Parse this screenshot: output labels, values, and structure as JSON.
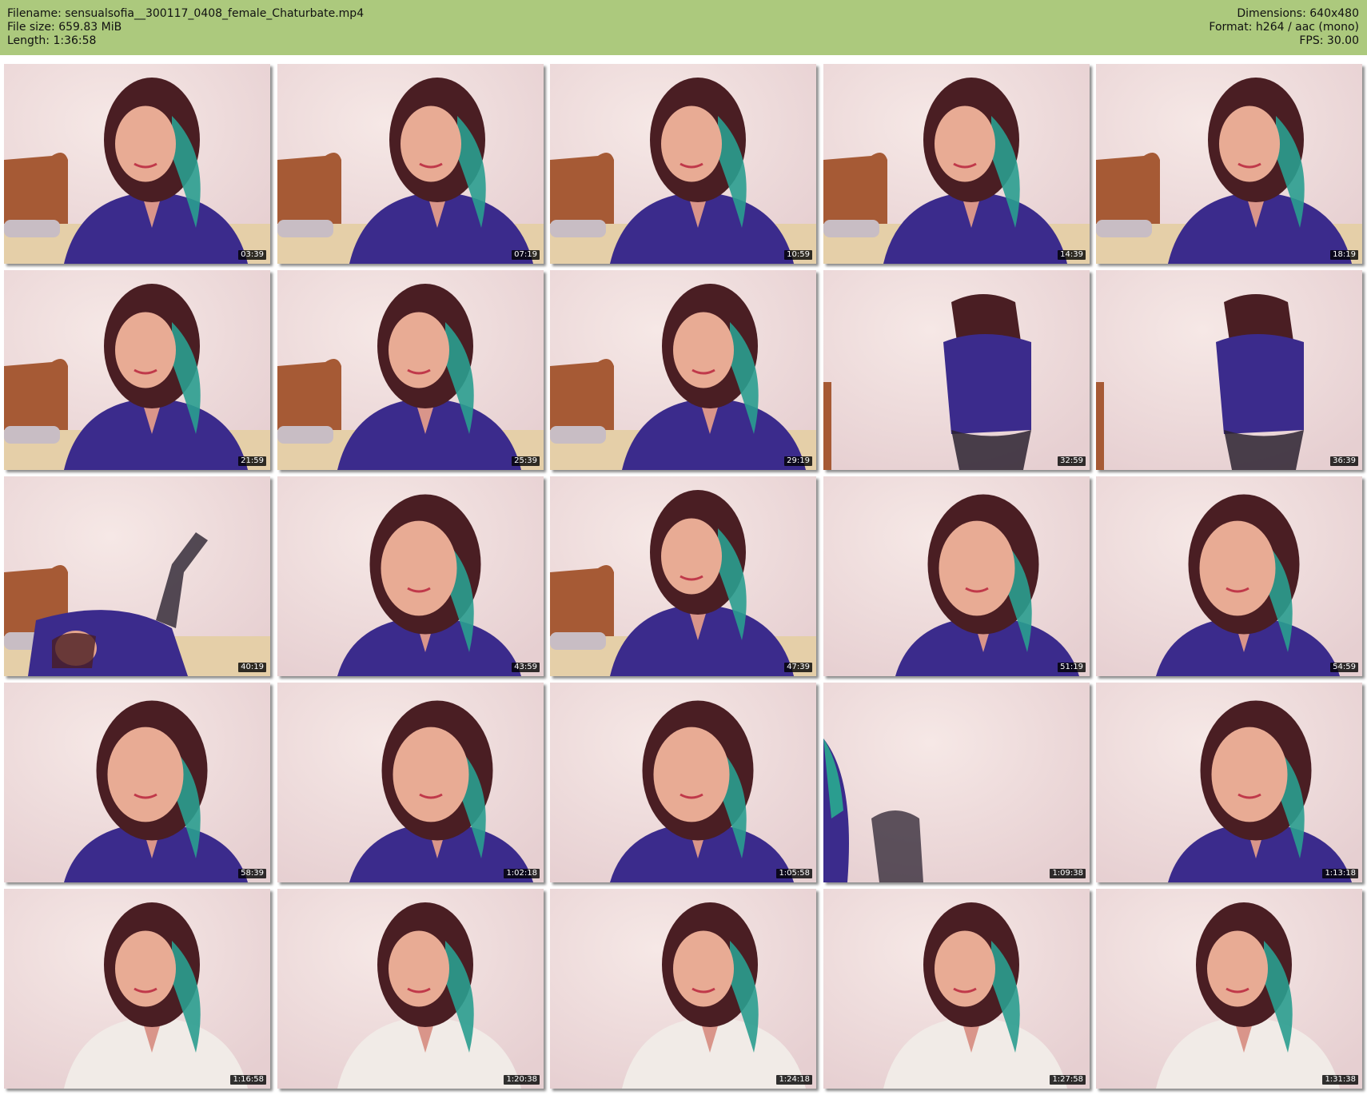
{
  "header": {
    "filename": "Filename: sensualsofia__300117_0408_female_Chaturbate.mp4",
    "filesize": "File size: 659.83 MiB",
    "length": "Length: 1:36:58",
    "dimensions": "Dimensions: 640x480",
    "format": "Format: h264 / aac (mono)",
    "fps": "FPS: 30.00"
  },
  "colors": {
    "header_bg": "#acc97d",
    "shirt_purple": "#3b2b8c",
    "hair_teal": "#2a9d8f",
    "wall_pink": "#ead7d6"
  },
  "thumbnails": [
    {
      "timestamp": "03:39",
      "scene": "bed"
    },
    {
      "timestamp": "07:19",
      "scene": "bed"
    },
    {
      "timestamp": "10:59",
      "scene": "bed"
    },
    {
      "timestamp": "14:39",
      "scene": "bed"
    },
    {
      "timestamp": "18:19",
      "scene": "bed"
    },
    {
      "timestamp": "21:59",
      "scene": "bed"
    },
    {
      "timestamp": "25:39",
      "scene": "bed"
    },
    {
      "timestamp": "29:19",
      "scene": "bed"
    },
    {
      "timestamp": "32:59",
      "scene": "wall"
    },
    {
      "timestamp": "36:39",
      "scene": "wall"
    },
    {
      "timestamp": "40:19",
      "scene": "lying"
    },
    {
      "timestamp": "43:59",
      "scene": "close"
    },
    {
      "timestamp": "47:39",
      "scene": "bed"
    },
    {
      "timestamp": "51:19",
      "scene": "close"
    },
    {
      "timestamp": "54:59",
      "scene": "close"
    },
    {
      "timestamp": "58:39",
      "scene": "close"
    },
    {
      "timestamp": "1:02:18",
      "scene": "close"
    },
    {
      "timestamp": "1:05:58",
      "scene": "close"
    },
    {
      "timestamp": "1:09:38",
      "scene": "empty"
    },
    {
      "timestamp": "1:13:18",
      "scene": "close"
    },
    {
      "timestamp": "1:16:58",
      "scene": "white"
    },
    {
      "timestamp": "1:20:38",
      "scene": "white"
    },
    {
      "timestamp": "1:24:18",
      "scene": "white"
    },
    {
      "timestamp": "1:27:58",
      "scene": "white"
    },
    {
      "timestamp": "1:31:38",
      "scene": "white"
    }
  ]
}
